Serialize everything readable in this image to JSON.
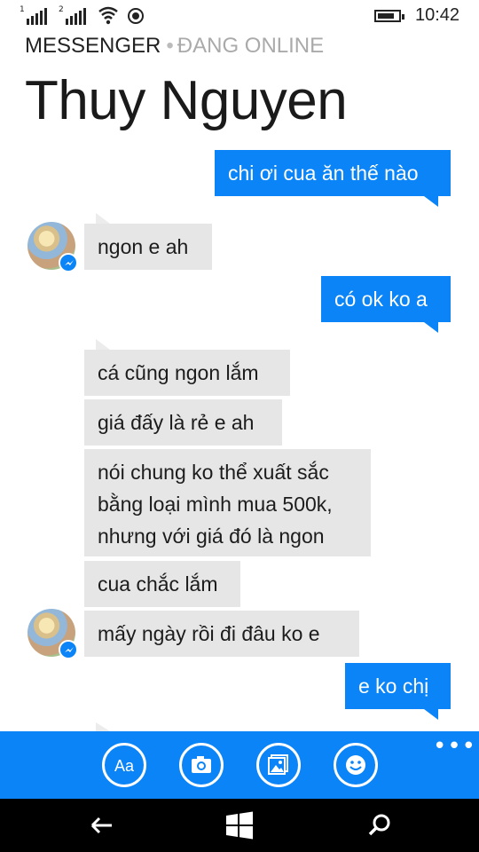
{
  "status_bar": {
    "sim1": "1",
    "sim2": "2",
    "time": "10:42",
    "icons": [
      "signal-icon",
      "signal-icon",
      "wifi-icon",
      "record-icon",
      "battery-icon"
    ]
  },
  "header": {
    "app_name": "MESSENGER",
    "separator": "•",
    "presence": "ĐANG ONLINE",
    "contact_name": "Thuy Nguyen"
  },
  "messages": [
    {
      "sender": "me",
      "text": "chi ơi cua ăn thế nào"
    },
    {
      "sender": "them",
      "text": "ngon e ah"
    },
    {
      "sender": "me",
      "text": "có ok ko a"
    },
    {
      "sender": "them",
      "text": "cá cũng ngon lắm"
    },
    {
      "sender": "them",
      "text": "giá đấy là rẻ e ah"
    },
    {
      "sender": "them",
      "text": "nói chung ko thể xuất sắc bằng loại mình mua 500k, nhưng với giá đó là ngon"
    },
    {
      "sender": "them",
      "text": "cua chắc lắm"
    },
    {
      "sender": "them",
      "text": "mấy ngày rồi đi đâu ko e"
    },
    {
      "sender": "me",
      "text": "e ko chị"
    }
  ],
  "app_bar": {
    "font_button_label": "Aa",
    "buttons": [
      "font-style-icon",
      "camera-icon",
      "photos-icon",
      "emoji-icon"
    ],
    "more_label": "•••"
  },
  "nav_bar": {
    "buttons": [
      "back-arrow-icon",
      "windows-start-icon",
      "search-icon"
    ]
  },
  "colors": {
    "accent": "#0a84f6",
    "incoming_bubble": "#e6e6e6",
    "outgoing_text": "#ffffff",
    "nav_background": "#000000"
  }
}
